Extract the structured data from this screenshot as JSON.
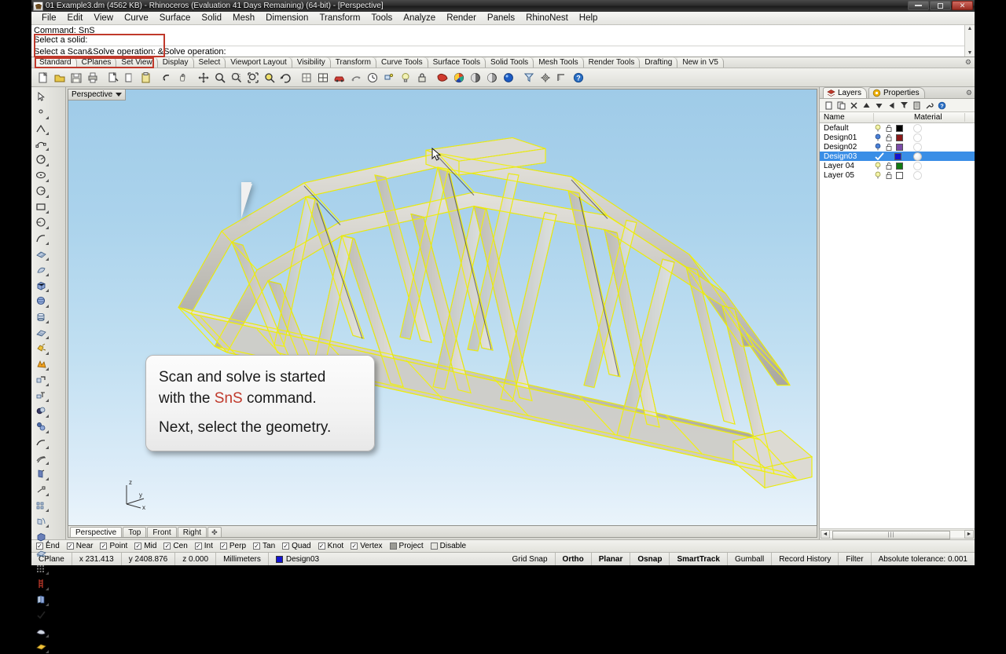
{
  "window": {
    "title": "01 Example3.dm (4562 KB) - Rhinoceros (Evaluation 41 Days Remaining) (64-bit) - [Perspective]",
    "app_icon": "rhino-logo-icon",
    "minimize_label": "Minimize",
    "restore_label": "Restore",
    "close_label": "Close"
  },
  "menu": {
    "items": [
      {
        "label": "File"
      },
      {
        "label": "Edit"
      },
      {
        "label": "View"
      },
      {
        "label": "Curve"
      },
      {
        "label": "Surface"
      },
      {
        "label": "Solid"
      },
      {
        "label": "Mesh"
      },
      {
        "label": "Dimension"
      },
      {
        "label": "Transform"
      },
      {
        "label": "Tools"
      },
      {
        "label": "Analyze"
      },
      {
        "label": "Render"
      },
      {
        "label": "Panels"
      },
      {
        "label": "RhinoNest"
      },
      {
        "label": "Help"
      }
    ]
  },
  "command": {
    "history_1": "Command: SnS",
    "history_2": "Select a solid:",
    "prompt": "Select a Scan&Solve operation: ‌&Solve operation:",
    "highlight_color": "#c0392b",
    "scroll_up": "▲",
    "scroll_down": "▼"
  },
  "toolbar_tabs": {
    "items": [
      {
        "label": "Standard",
        "active": true
      },
      {
        "label": "CPlanes",
        "active": false
      },
      {
        "label": "Set View",
        "active": false
      },
      {
        "label": "Display",
        "active": false
      },
      {
        "label": "Select",
        "active": false
      },
      {
        "label": "Viewport Layout",
        "active": false
      },
      {
        "label": "Visibility",
        "active": false
      },
      {
        "label": "Transform",
        "active": false
      },
      {
        "label": "Curve Tools",
        "active": false
      },
      {
        "label": "Surface Tools",
        "active": false
      },
      {
        "label": "Solid Tools",
        "active": false
      },
      {
        "label": "Mesh Tools",
        "active": false
      },
      {
        "label": "Render Tools",
        "active": false
      },
      {
        "label": "Drafting",
        "active": false
      },
      {
        "label": "New in V5",
        "active": false
      }
    ],
    "options_icon": "gear-icon"
  },
  "main_toolbar": {
    "icons": [
      "new-file-icon",
      "open-folder-icon",
      "save-icon",
      "print-icon",
      "cut-icon",
      "copy-icon",
      "paste-icon",
      "undo-icon",
      "redo-hand-icon",
      "pan-icon",
      "move-icon",
      "zoom-in-icon",
      "zoom-window-icon",
      "zoom-extents-icon",
      "zoom-selected-icon",
      "rotate-view-icon",
      "grid-snap-icon",
      "viewport-layout-icon",
      "render-car-icon",
      "history-icon",
      "clock-icon",
      "named-position-icon",
      "light-bulb-icon",
      "lock-icon",
      "rhino-render-icon",
      "color-wheel-icon",
      "shade-view-icon",
      "ghosted-view-icon",
      "rendered-view-icon",
      "select-filter-icon",
      "options-gear-icon",
      "measure-icon",
      "help-icon"
    ]
  },
  "side_palette": {
    "tools": [
      "select-arrow-icon",
      "select-point-icon",
      "polyline-icon",
      "curve-control-points-icon",
      "circle-icon",
      "ellipse-icon",
      "arc-icon",
      "rectangle-icon",
      "polygon-icon",
      "freeform-curve-icon",
      "surface-from-points-icon",
      "surface-revolve-icon",
      "box-icon",
      "sphere-icon",
      "cylinder-icon",
      "surface-patch-icon",
      "explode-icon",
      "boolean-split-icon",
      "fillet-edge-icon",
      "chamfer-edge-icon",
      "boolean-union-icon",
      "boolean-difference-icon",
      "blend-curve-icon",
      "offset-curve-icon",
      "extrude-icon",
      "taper-icon",
      "array-icon",
      "flow-along-curve-icon",
      "mesh-from-surface-icon",
      "mesh-tools-icon",
      "grid-array-icon",
      "scaffold-icon",
      "copy-object-icon",
      "check-mark-icon",
      "blend-surface-icon",
      "plane-surface-icon"
    ]
  },
  "viewport": {
    "title": "Perspective",
    "dropdown_icon": "chevron-down-icon",
    "cursor_icon": "arrow-cursor-icon",
    "axis": {
      "x_label": "x",
      "y_label": "y",
      "z_label": "z"
    },
    "background_top": "#9fcbe8",
    "background_bottom": "#eaf4fb",
    "selection_color": "#f2f20a",
    "model_description": "Shaded steel truss bridge model with selected yellow wireframe members"
  },
  "callout": {
    "line1_a": "Scan and solve is started",
    "line2_a": "with the ",
    "line2_highlight": "SnS",
    "line2_b": " command.",
    "line3": "Next, select the geometry.",
    "highlight_color": "#c0392b"
  },
  "viewport_tabs": {
    "items": [
      {
        "label": "Perspective",
        "active": true
      },
      {
        "label": "Top",
        "active": false
      },
      {
        "label": "Front",
        "active": false
      },
      {
        "label": "Right",
        "active": false
      }
    ],
    "add_label": "✤"
  },
  "right_panel": {
    "tabs": [
      {
        "label": "Layers",
        "icon": "layers-icon",
        "active": true
      },
      {
        "label": "Properties",
        "icon": "properties-icon",
        "active": false
      }
    ],
    "options_icon": "gear-icon",
    "toolbar_icons": [
      "new-layer-icon",
      "new-sublayer-icon",
      "delete-layer-icon",
      "move-up-icon",
      "move-down-icon",
      "previous-icon",
      "filter-icon",
      "properties-panel-icon",
      "layer-tools-icon",
      "help-icon"
    ],
    "columns": {
      "name": "Name",
      "material": "Material"
    },
    "layers": [
      {
        "name": "Default",
        "on": true,
        "bulb": "off",
        "lock": "unlocked",
        "color": "#000000",
        "selected": false,
        "material": false
      },
      {
        "name": "Design01",
        "on": true,
        "bulb": "on",
        "lock": "unlocked",
        "color": "#8b1a1a",
        "selected": false,
        "material": false
      },
      {
        "name": "Design02",
        "on": true,
        "bulb": "on",
        "lock": "unlocked",
        "color": "#7b4ba8",
        "selected": false,
        "material": false
      },
      {
        "name": "Design03",
        "on": true,
        "bulb": "current",
        "lock": "unlocked",
        "color": "#1414cf",
        "selected": true,
        "material": true
      },
      {
        "name": "Layer 04",
        "on": true,
        "bulb": "off",
        "lock": "unlocked",
        "color": "#127a12",
        "selected": false,
        "material": false
      },
      {
        "name": "Layer 05",
        "on": true,
        "bulb": "off",
        "lock": "unlocked",
        "color": "#ffffff",
        "selected": false,
        "material": false
      }
    ],
    "hscroll": {
      "left": "◄",
      "right": "►"
    }
  },
  "osnap_bar": {
    "items": [
      {
        "label": "End",
        "state": "checked"
      },
      {
        "label": "Near",
        "state": "checked"
      },
      {
        "label": "Point",
        "state": "checked"
      },
      {
        "label": "Mid",
        "state": "checked"
      },
      {
        "label": "Cen",
        "state": "checked"
      },
      {
        "label": "Int",
        "state": "checked"
      },
      {
        "label": "Perp",
        "state": "checked"
      },
      {
        "label": "Tan",
        "state": "checked"
      },
      {
        "label": "Quad",
        "state": "checked"
      },
      {
        "label": "Knot",
        "state": "checked"
      },
      {
        "label": "Vertex",
        "state": "checked"
      },
      {
        "label": "Project",
        "state": "gray"
      },
      {
        "label": "Disable",
        "state": "empty"
      }
    ],
    "check_glyph": "✓"
  },
  "status_bar": {
    "cplane": "CPlane",
    "x": "x 231.413",
    "y": "y 2408.876",
    "z": "z 0.000",
    "units": "Millimeters",
    "layer": "Design03",
    "layer_color": "#1414cf",
    "toggles": [
      {
        "label": "Grid Snap",
        "on": false
      },
      {
        "label": "Ortho",
        "on": true
      },
      {
        "label": "Planar",
        "on": true
      },
      {
        "label": "Osnap",
        "on": true
      },
      {
        "label": "SmartTrack",
        "on": true
      },
      {
        "label": "Gumball",
        "on": false
      },
      {
        "label": "Record History",
        "on": false
      },
      {
        "label": "Filter",
        "on": false
      }
    ],
    "tolerance": "Absolute tolerance: 0.001"
  }
}
